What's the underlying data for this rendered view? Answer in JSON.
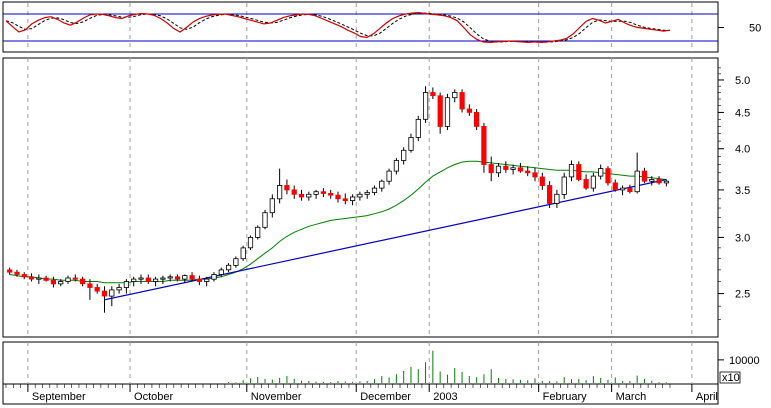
{
  "chart_data": {
    "type": "candlestick",
    "colors": {
      "background": "#ffffff",
      "frame": "#000000",
      "grid": "#a0a0a0",
      "up_body": "#ffffff",
      "down_body": "#ff0000",
      "moving_average": "#008000",
      "trendline": "#0000c0",
      "oscillator": "#d00000",
      "oscillator_signal": "#000000",
      "oscillator_band": "#0000c0",
      "volume": "#008000"
    },
    "oscillator": {
      "y_ticks": [
        "50"
      ],
      "ylim": [
        0,
        100
      ],
      "upper_band": 80,
      "lower_band": 20,
      "values": [
        65,
        52,
        40,
        45,
        58,
        66,
        72,
        74,
        68,
        60,
        55,
        62,
        71,
        78,
        80,
        79,
        76,
        72,
        70,
        76,
        79,
        81,
        80,
        77,
        70,
        60,
        48,
        40,
        50,
        62,
        70,
        75,
        78,
        79,
        80,
        77,
        74,
        70,
        66,
        62,
        58,
        60,
        66,
        72,
        76,
        78,
        80,
        79,
        76,
        70,
        64,
        58,
        52,
        44,
        38,
        30,
        28,
        36,
        48,
        60,
        70,
        76,
        80,
        82,
        83,
        81,
        79,
        78,
        76,
        72,
        65,
        50,
        34,
        24,
        18,
        17,
        18,
        19,
        20,
        19,
        18,
        17,
        18,
        17,
        18,
        20,
        22,
        26,
        36,
        50,
        64,
        70,
        66,
        60,
        64,
        68,
        60,
        54,
        50,
        48,
        46,
        44,
        42,
        44
      ]
    },
    "price": {
      "y_scale": "log",
      "ylim": [
        2.2,
        5.3
      ],
      "y_ticks": [
        "5.0",
        "4.5",
        "4.0",
        "3.5",
        "3.0",
        "2.5"
      ],
      "tick_values": [
        5.0,
        4.5,
        4.0,
        3.5,
        3.0,
        2.5
      ],
      "x_ticks": [
        "September",
        "October",
        "November",
        "December",
        "2003",
        "February",
        "March",
        "April"
      ],
      "candles": [
        [
          2.7,
          2.72,
          2.66,
          2.68
        ],
        [
          2.68,
          2.7,
          2.64,
          2.66
        ],
        [
          2.66,
          2.68,
          2.62,
          2.64
        ],
        [
          2.64,
          2.67,
          2.6,
          2.62
        ],
        [
          2.62,
          2.66,
          2.58,
          2.63
        ],
        [
          2.63,
          2.65,
          2.6,
          2.61
        ],
        [
          2.61,
          2.64,
          2.55,
          2.58
        ],
        [
          2.58,
          2.62,
          2.56,
          2.6
        ],
        [
          2.6,
          2.65,
          2.58,
          2.63
        ],
        [
          2.63,
          2.66,
          2.6,
          2.62
        ],
        [
          2.62,
          2.64,
          2.56,
          2.58
        ],
        [
          2.58,
          2.62,
          2.45,
          2.55
        ],
        [
          2.55,
          2.58,
          2.5,
          2.52
        ],
        [
          2.52,
          2.56,
          2.35,
          2.48
        ],
        [
          2.48,
          2.56,
          2.4,
          2.53
        ],
        [
          2.53,
          2.58,
          2.5,
          2.55
        ],
        [
          2.55,
          2.62,
          2.5,
          2.6
        ],
        [
          2.6,
          2.64,
          2.56,
          2.62
        ],
        [
          2.62,
          2.66,
          2.58,
          2.63
        ],
        [
          2.63,
          2.66,
          2.58,
          2.6
        ],
        [
          2.6,
          2.64,
          2.56,
          2.62
        ],
        [
          2.62,
          2.65,
          2.58,
          2.63
        ],
        [
          2.63,
          2.66,
          2.6,
          2.64
        ],
        [
          2.64,
          2.66,
          2.6,
          2.62
        ],
        [
          2.62,
          2.66,
          2.59,
          2.65
        ],
        [
          2.65,
          2.68,
          2.6,
          2.62
        ],
        [
          2.62,
          2.65,
          2.57,
          2.6
        ],
        [
          2.6,
          2.64,
          2.56,
          2.62
        ],
        [
          2.62,
          2.68,
          2.6,
          2.66
        ],
        [
          2.66,
          2.72,
          2.64,
          2.7
        ],
        [
          2.7,
          2.76,
          2.68,
          2.74
        ],
        [
          2.74,
          2.82,
          2.72,
          2.8
        ],
        [
          2.8,
          2.92,
          2.78,
          2.9
        ],
        [
          2.9,
          3.02,
          2.88,
          3.0
        ],
        [
          3.0,
          3.12,
          2.98,
          3.1
        ],
        [
          3.1,
          3.28,
          3.08,
          3.25
        ],
        [
          3.25,
          3.45,
          3.2,
          3.4
        ],
        [
          3.4,
          3.75,
          3.35,
          3.55
        ],
        [
          3.55,
          3.62,
          3.45,
          3.5
        ],
        [
          3.5,
          3.55,
          3.4,
          3.45
        ],
        [
          3.45,
          3.5,
          3.38,
          3.42
        ],
        [
          3.42,
          3.48,
          3.38,
          3.45
        ],
        [
          3.45,
          3.5,
          3.4,
          3.48
        ],
        [
          3.48,
          3.52,
          3.42,
          3.46
        ],
        [
          3.46,
          3.5,
          3.4,
          3.44
        ],
        [
          3.44,
          3.48,
          3.36,
          3.4
        ],
        [
          3.4,
          3.46,
          3.34,
          3.38
        ],
        [
          3.38,
          3.45,
          3.33,
          3.42
        ],
        [
          3.42,
          3.48,
          3.38,
          3.45
        ],
        [
          3.45,
          3.5,
          3.4,
          3.47
        ],
        [
          3.47,
          3.55,
          3.44,
          3.52
        ],
        [
          3.52,
          3.62,
          3.48,
          3.6
        ],
        [
          3.6,
          3.75,
          3.56,
          3.72
        ],
        [
          3.72,
          3.88,
          3.68,
          3.85
        ],
        [
          3.85,
          4.02,
          3.8,
          3.98
        ],
        [
          3.98,
          4.2,
          3.95,
          4.15
        ],
        [
          4.15,
          4.45,
          4.1,
          4.4
        ],
        [
          4.4,
          4.9,
          4.35,
          4.8
        ],
        [
          4.8,
          4.88,
          4.7,
          4.75
        ],
        [
          4.75,
          4.8,
          4.2,
          4.3
        ],
        [
          4.3,
          4.78,
          4.25,
          4.72
        ],
        [
          4.72,
          4.85,
          4.65,
          4.8
        ],
        [
          4.8,
          4.85,
          4.5,
          4.55
        ],
        [
          4.55,
          4.62,
          4.45,
          4.5
        ],
        [
          4.5,
          4.55,
          4.25,
          4.3
        ],
        [
          4.3,
          4.35,
          3.7,
          3.8
        ],
        [
          3.8,
          3.9,
          3.6,
          3.7
        ],
        [
          3.7,
          3.82,
          3.65,
          3.78
        ],
        [
          3.78,
          3.84,
          3.7,
          3.74
        ],
        [
          3.74,
          3.8,
          3.68,
          3.76
        ],
        [
          3.76,
          3.82,
          3.7,
          3.72
        ],
        [
          3.72,
          3.78,
          3.66,
          3.7
        ],
        [
          3.7,
          3.76,
          3.6,
          3.65
        ],
        [
          3.65,
          3.7,
          3.5,
          3.55
        ],
        [
          3.55,
          3.6,
          3.3,
          3.35
        ],
        [
          3.35,
          3.5,
          3.3,
          3.45
        ],
        [
          3.45,
          3.7,
          3.4,
          3.65
        ],
        [
          3.65,
          3.85,
          3.6,
          3.8
        ],
        [
          3.8,
          3.84,
          3.6,
          3.62
        ],
        [
          3.62,
          3.68,
          3.5,
          3.52
        ],
        [
          3.52,
          3.7,
          3.48,
          3.66
        ],
        [
          3.66,
          3.8,
          3.62,
          3.75
        ],
        [
          3.75,
          3.78,
          3.55,
          3.58
        ],
        [
          3.58,
          3.62,
          3.48,
          3.5
        ],
        [
          3.5,
          3.55,
          3.44,
          3.52
        ],
        [
          3.52,
          3.56,
          3.46,
          3.48
        ],
        [
          3.48,
          3.95,
          3.46,
          3.72
        ],
        [
          3.72,
          3.76,
          3.58,
          3.6
        ],
        [
          3.6,
          3.66,
          3.55,
          3.62
        ],
        [
          3.62,
          3.66,
          3.56,
          3.58
        ],
        [
          3.58,
          3.62,
          3.54,
          3.6
        ]
      ],
      "moving_average": [
        2.66,
        2.65,
        2.64,
        2.64,
        2.63,
        2.62,
        2.62,
        2.61,
        2.61,
        2.61,
        2.6,
        2.6,
        2.6,
        2.59,
        2.59,
        2.59,
        2.59,
        2.6,
        2.6,
        2.6,
        2.6,
        2.6,
        2.61,
        2.61,
        2.61,
        2.61,
        2.62,
        2.62,
        2.63,
        2.64,
        2.66,
        2.68,
        2.71,
        2.75,
        2.8,
        2.85,
        2.9,
        2.96,
        3.01,
        3.05,
        3.08,
        3.11,
        3.13,
        3.15,
        3.17,
        3.18,
        3.19,
        3.2,
        3.21,
        3.22,
        3.24,
        3.26,
        3.29,
        3.33,
        3.38,
        3.44,
        3.51,
        3.59,
        3.66,
        3.71,
        3.76,
        3.8,
        3.83,
        3.84,
        3.84,
        3.83,
        3.82,
        3.81,
        3.8,
        3.79,
        3.78,
        3.77,
        3.76,
        3.75,
        3.74,
        3.73,
        3.73,
        3.73,
        3.72,
        3.71,
        3.71,
        3.7,
        3.69,
        3.68,
        3.67,
        3.66,
        3.66,
        3.65,
        3.64,
        3.63,
        3.62
      ],
      "trendline": [
        [
          13,
          2.45
        ],
        [
          90,
          3.62
        ]
      ]
    },
    "volume": {
      "y_ticks": [
        "10000"
      ],
      "multiplier_label": "x10",
      "ylim": [
        0,
        1600
      ],
      "values": [
        0,
        0,
        0,
        0,
        0,
        0,
        0,
        0,
        0,
        0,
        0,
        0,
        0,
        0,
        0,
        0,
        0,
        0,
        0,
        0,
        0,
        0,
        0,
        0,
        0,
        0,
        0,
        0,
        0,
        0,
        40,
        30,
        120,
        200,
        260,
        180,
        150,
        220,
        300,
        180,
        100,
        90,
        60,
        50,
        40,
        80,
        60,
        50,
        70,
        90,
        160,
        300,
        240,
        380,
        520,
        700,
        600,
        900,
        1400,
        500,
        360,
        650,
        480,
        300,
        250,
        380,
        600,
        220,
        180,
        160,
        140,
        120,
        200,
        90,
        80,
        70,
        250,
        160,
        180,
        120,
        300,
        220,
        140,
        240,
        90,
        80,
        320,
        180,
        100,
        40,
        30
      ]
    }
  }
}
